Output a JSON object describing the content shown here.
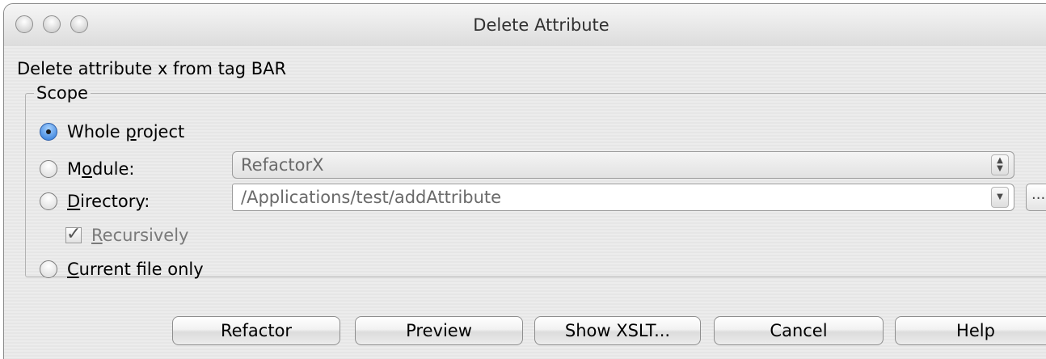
{
  "window": {
    "title": "Delete Attribute"
  },
  "description": "Delete attribute x from tag BAR",
  "scope": {
    "legend": "Scope",
    "options": {
      "whole_project": {
        "pre": "Whole ",
        "mnemonic": "p",
        "post": "roject",
        "selected": true
      },
      "module": {
        "pre": "M",
        "mnemonic": "o",
        "post": "dule:",
        "selected": false
      },
      "directory": {
        "pre": "",
        "mnemonic": "D",
        "post": "irectory:",
        "selected": false
      },
      "current_file": {
        "pre": "",
        "mnemonic": "C",
        "post": "urrent file only",
        "selected": false
      }
    },
    "module_value": "RefactorX",
    "directory_value": "/Applications/test/addAttribute",
    "browse_label": "...",
    "recursively": {
      "pre": "",
      "mnemonic": "R",
      "post": "ecursively",
      "checked": true
    }
  },
  "buttons": {
    "refactor": "Refactor",
    "preview": "Preview",
    "show_xslt": "Show XSLT...",
    "cancel": "Cancel",
    "help": "Help"
  },
  "colors": {
    "accent": "#2a76d6",
    "window_bg": "#ececec"
  }
}
